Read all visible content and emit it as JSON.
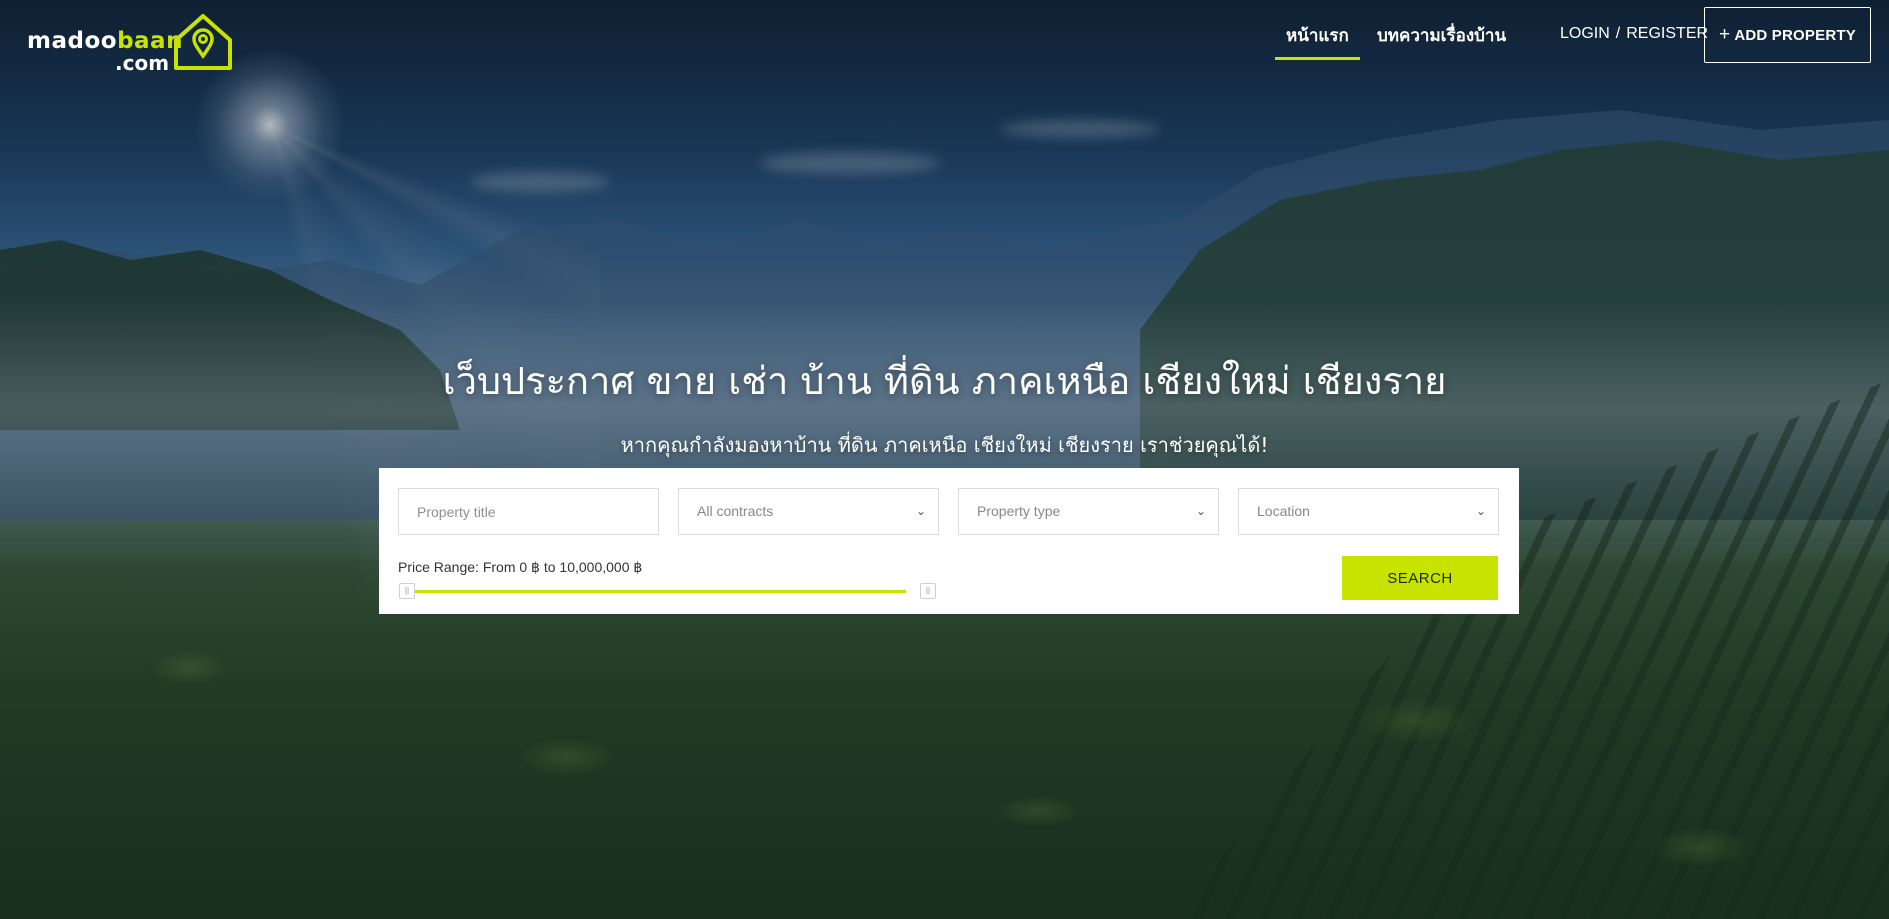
{
  "brand": {
    "logo_text_main": "madoo",
    "logo_text_accent": "baan",
    "logo_text_domain": ".com",
    "accent_color": "#c8e300"
  },
  "nav": {
    "items": [
      {
        "label": "หน้าแรก",
        "active": true
      },
      {
        "label": "บทความเรื่องบ้าน",
        "active": false
      }
    ],
    "login_label": "LOGIN",
    "separator": "/",
    "register_label": "REGISTER",
    "add_property_label": "ADD PROPERTY",
    "add_property_icon": "plus-icon"
  },
  "hero": {
    "title": "เว็บประกาศ ขาย เช่า บ้าน ที่ดิน ภาคเหนือ เชียงใหม่ เชียงราย",
    "subtitle": "หากคุณกำลังมองหาบ้าน ที่ดิน ภาคเหนือ เชียงใหม่ เชียงราย เราช่วยคุณได้!"
  },
  "search": {
    "title_placeholder": "Property title",
    "contract_selected": "All contracts",
    "type_selected": "Property type",
    "location_selected": "Location",
    "price_range_label": "Price Range: From 0 ฿ to 10,000,000 ฿",
    "price_min": 0,
    "price_max": 10000000,
    "button_label": "SEARCH"
  }
}
